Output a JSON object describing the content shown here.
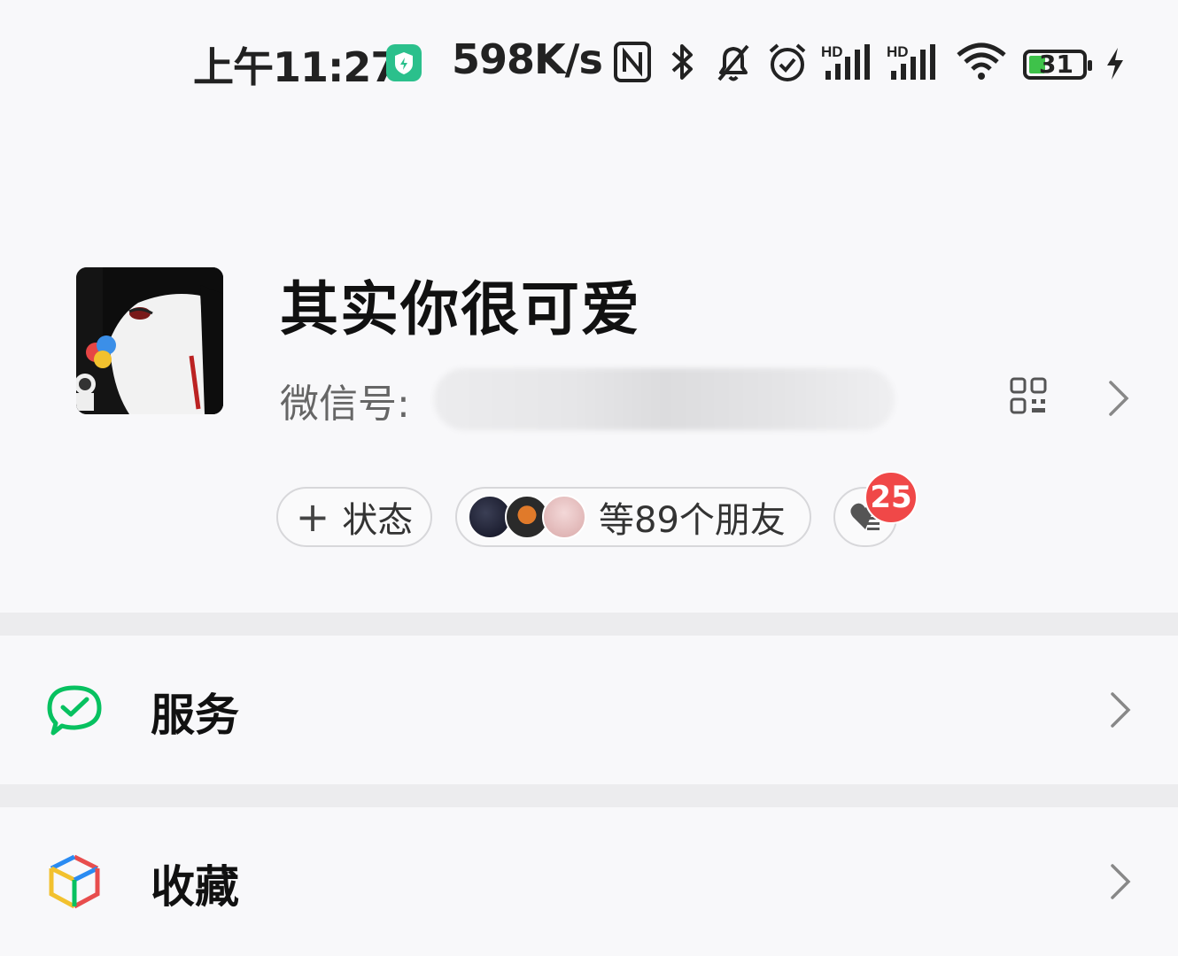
{
  "status_bar": {
    "time": "上午11:27",
    "net_speed": "598K/s",
    "battery_level": "31",
    "network_tag_1": "HD",
    "network_tag_2": "HD"
  },
  "profile": {
    "nickname": "其实你很可爱",
    "wechat_id_label": "微信号:",
    "status_button": "状态",
    "status_plus": "+",
    "friends_text": "等89个朋友",
    "like_badge_count": "25"
  },
  "menu": [
    {
      "label": "服务",
      "icon": "wechat-pay-icon"
    },
    {
      "label": "收藏",
      "icon": "favorites-cube-icon"
    }
  ],
  "colors": {
    "accent_green": "#07c160",
    "badge_red": "#f04848",
    "shield_green": "#2bc08c"
  }
}
